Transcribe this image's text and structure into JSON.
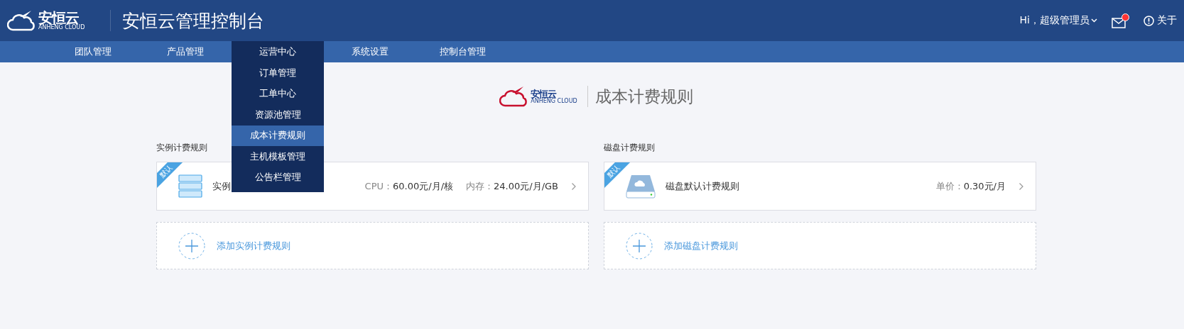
{
  "header": {
    "logo_text": "安恒云",
    "logo_subtext": "ANHENG CLOUD",
    "title": "安恒云管理控制台",
    "user": "Hi，超级管理员",
    "mail_unread": true,
    "about": "关于"
  },
  "nav": [
    {
      "label": "团队管理",
      "expanded": false
    },
    {
      "label": "产品管理",
      "expanded": false
    },
    {
      "label": "运营中心",
      "expanded": true,
      "children": [
        {
          "label": "订单管理",
          "selected": false
        },
        {
          "label": "工单中心",
          "selected": false
        },
        {
          "label": "资源池管理",
          "selected": false
        },
        {
          "label": "成本计费规则",
          "selected": true
        },
        {
          "label": "主机模板管理",
          "selected": false
        },
        {
          "label": "公告栏管理",
          "selected": false
        }
      ]
    },
    {
      "label": "系统设置",
      "expanded": false
    },
    {
      "label": "控制台管理",
      "expanded": false
    }
  ],
  "page_title": {
    "logo_text": "安恒云",
    "logo_subtext": "ANHENG CLOUD",
    "title": "成本计费规则"
  },
  "sections": [
    {
      "kind": "instance",
      "title": "实例计费规则",
      "rule": {
        "badge": "默认",
        "name": "实例",
        "prices": [
          {
            "label": "CPU：",
            "value": "60.00元/月/核"
          },
          {
            "label": "内存：",
            "value": "24.00元/月/GB"
          }
        ]
      },
      "add_label": "添加实例计费规则"
    },
    {
      "kind": "disk",
      "title": "磁盘计费规则",
      "rule": {
        "badge": "默认",
        "name": "磁盘默认计费规则",
        "prices": [
          {
            "label": "单价：",
            "value": "0.30元/月"
          }
        ]
      },
      "add_label": "添加磁盘计费规则"
    }
  ]
}
